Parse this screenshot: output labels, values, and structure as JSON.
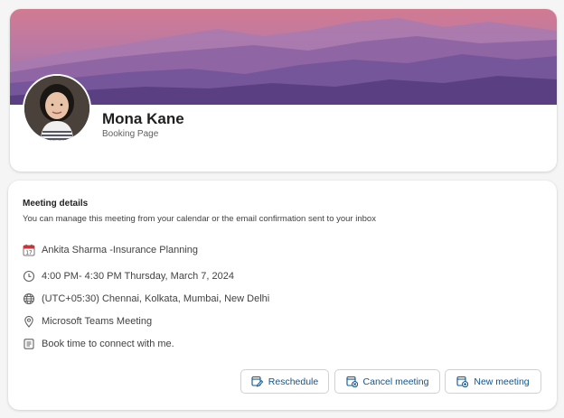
{
  "profile": {
    "name": "Mona Kane",
    "subtitle": "Booking Page"
  },
  "meeting": {
    "section_title": "Meeting details",
    "description": "You can manage this meeting from your calendar or the email confirmation sent to your inbox",
    "items": [
      {
        "icon": "calendar-icon",
        "text": "Ankita Sharma -Insurance Planning"
      },
      {
        "icon": "clock-icon",
        "text": "4:00 PM- 4:30 PM Thursday, March 7, 2024"
      },
      {
        "icon": "globe-icon",
        "text": "(UTC+05:30) Chennai, Kolkata, Mumbai, New Delhi"
      },
      {
        "icon": "location-icon",
        "text": "Microsoft Teams Meeting"
      },
      {
        "icon": "notes-icon",
        "text": "Book time to connect with me."
      }
    ]
  },
  "actions": {
    "reschedule_label": "Reschedule",
    "cancel_label": "Cancel meeting",
    "new_label": "New meeting"
  },
  "colors": {
    "accent": "#0f548c",
    "background": "#f5f5f5",
    "banner_sky_top": "#d27a92",
    "banner_mountain": "#5a3f83"
  }
}
